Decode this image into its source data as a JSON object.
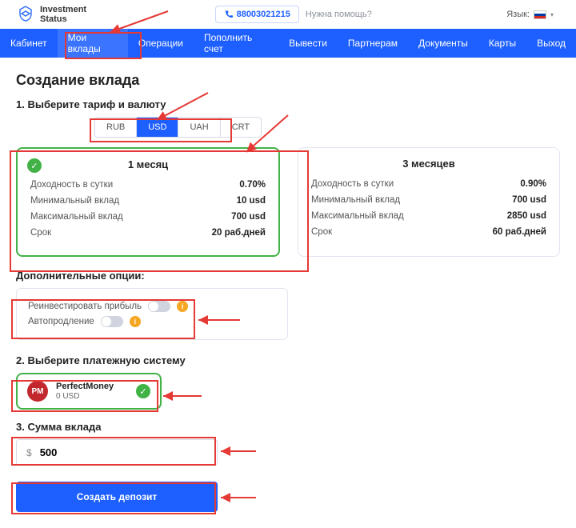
{
  "brand": {
    "line1": "Investment",
    "line2": "Status"
  },
  "phone": "88003021215",
  "help": "Нужна помощь?",
  "lang_label": "Язык:",
  "nav": [
    {
      "label": "Кабинет"
    },
    {
      "label": "Мои вклады",
      "active": true
    },
    {
      "label": "Операции"
    },
    {
      "label": "Пополнить счет"
    },
    {
      "label": "Вывести"
    },
    {
      "label": "Партнерам"
    },
    {
      "label": "Документы"
    },
    {
      "label": "Карты"
    },
    {
      "label": "Выход"
    }
  ],
  "page_title": "Создание вклада",
  "step1_title": "1. Выберите тариф и валюту",
  "currencies": [
    {
      "code": "RUB"
    },
    {
      "code": "USD",
      "active": true
    },
    {
      "code": "UAH"
    },
    {
      "code": "CRT"
    }
  ],
  "plans": [
    {
      "title": "1 месяц",
      "selected": true,
      "rows": [
        {
          "label": "Доходность в сутки",
          "value": "0.70%"
        },
        {
          "label": "Минимальный вклад",
          "value": "10 usd"
        },
        {
          "label": "Максимальный вклад",
          "value": "700 usd"
        },
        {
          "label": "Срок",
          "value": "20 раб.дней"
        }
      ]
    },
    {
      "title": "3 месяцев",
      "selected": false,
      "rows": [
        {
          "label": "Доходность в сутки",
          "value": "0.90%"
        },
        {
          "label": "Минимальный вклад",
          "value": "700 usd"
        },
        {
          "label": "Максимальный вклад",
          "value": "2850 usd"
        },
        {
          "label": "Срок",
          "value": "60 раб.дней"
        }
      ]
    }
  ],
  "options_title": "Дополнительные опции:",
  "options": [
    {
      "label": "Реинвестировать прибыль"
    },
    {
      "label": "Автопродление"
    }
  ],
  "step2_title": "2. Выберите платежную систему",
  "payment": {
    "name": "PerfectMoney",
    "balance": "0 USD"
  },
  "step3_title": "3. Сумма вклада",
  "amount": {
    "currency": "$",
    "value": "500"
  },
  "create_button": "Создать депозит"
}
